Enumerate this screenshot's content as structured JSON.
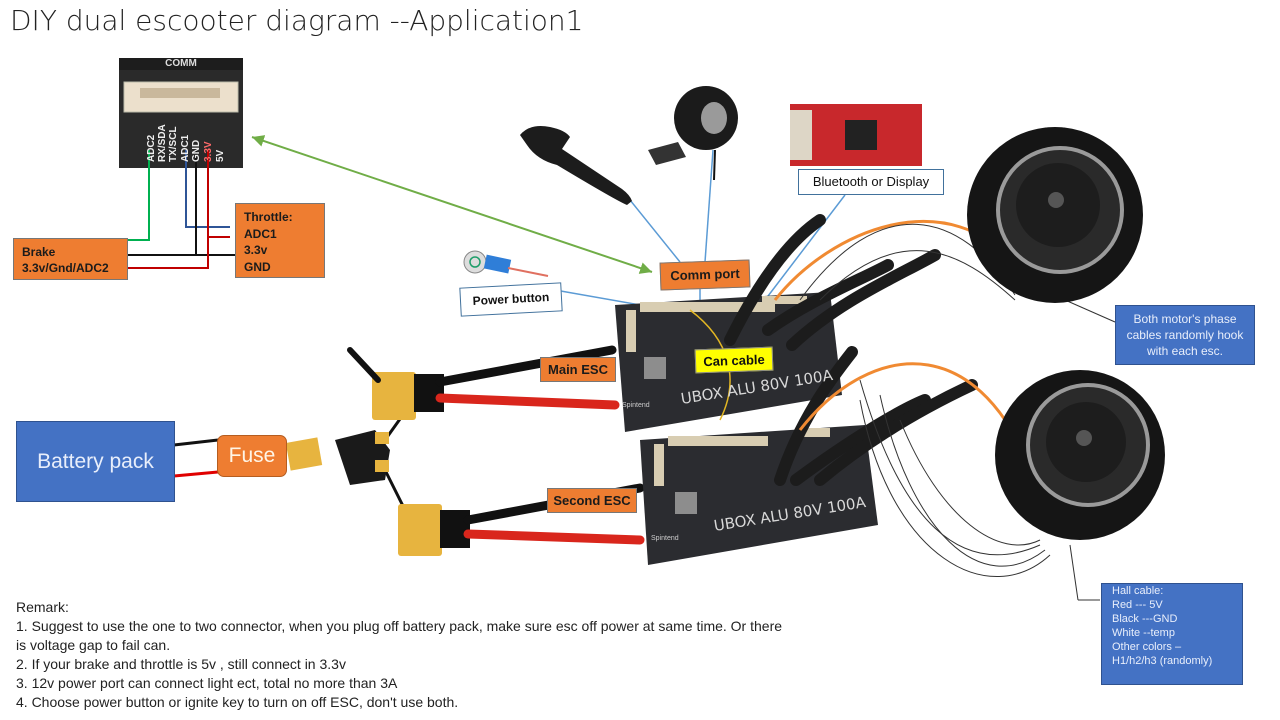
{
  "title": "DIY dual escooter diagram   --Application1",
  "comm_connector": {
    "header": "COMM",
    "pins": [
      "ADC2",
      "RX/SDA",
      "TX/SCL",
      "ADC1",
      "GND",
      "3.3V",
      "5V"
    ]
  },
  "labels": {
    "brake_line1": "Brake",
    "brake_line2": "3.3v/Gnd/ADC2",
    "throttle_title": "Throttle:",
    "throttle_line1": "ADC1",
    "throttle_line2": "3.3v",
    "throttle_line3": "GND",
    "comm_port": "Comm port",
    "power_button": "Power button",
    "bluetooth": "Bluetooth or Display",
    "main_esc": "Main ESC",
    "second_esc": "Second ESC",
    "can_cable": "Can cable",
    "battery_pack": "Battery pack",
    "fuse": "Fuse",
    "phase_note": "Both motor's phase cables randomly hook with each esc."
  },
  "esc_units": [
    {
      "model": "UBOX ALU 80V 100A",
      "brand": "Spintend"
    },
    {
      "model": "UBOX ALU 80V 100A",
      "brand": "Spintend"
    }
  ],
  "hall_cable": {
    "title": "Hall cable:",
    "lines": [
      "Red --- 5V",
      "Black ---GND",
      "White --temp",
      "Other colors –",
      "H1/h2/h3 (randomly)"
    ]
  },
  "remarks": {
    "title": "Remark:",
    "items": [
      "1. Suggest to use the one to two connector, when you plug off battery pack, make sure esc off power at same time. Or there",
      "is voltage gap to fail can.",
      "2.  If your brake and throttle is 5v , still connect in 3.3v",
      "3. 12v power port can connect light ect, total no more than 3A",
      "4. Choose power button or ignite key to turn on off ESC, don't use both."
    ]
  },
  "colors": {
    "orange": "#ee7d31",
    "blue": "#4472c4",
    "can_yellow": "#ffff00",
    "arrow_green": "#70ad47",
    "wire_red": "#e02020",
    "wire_green": "#00b050",
    "wire_blue": "#2f5597"
  }
}
